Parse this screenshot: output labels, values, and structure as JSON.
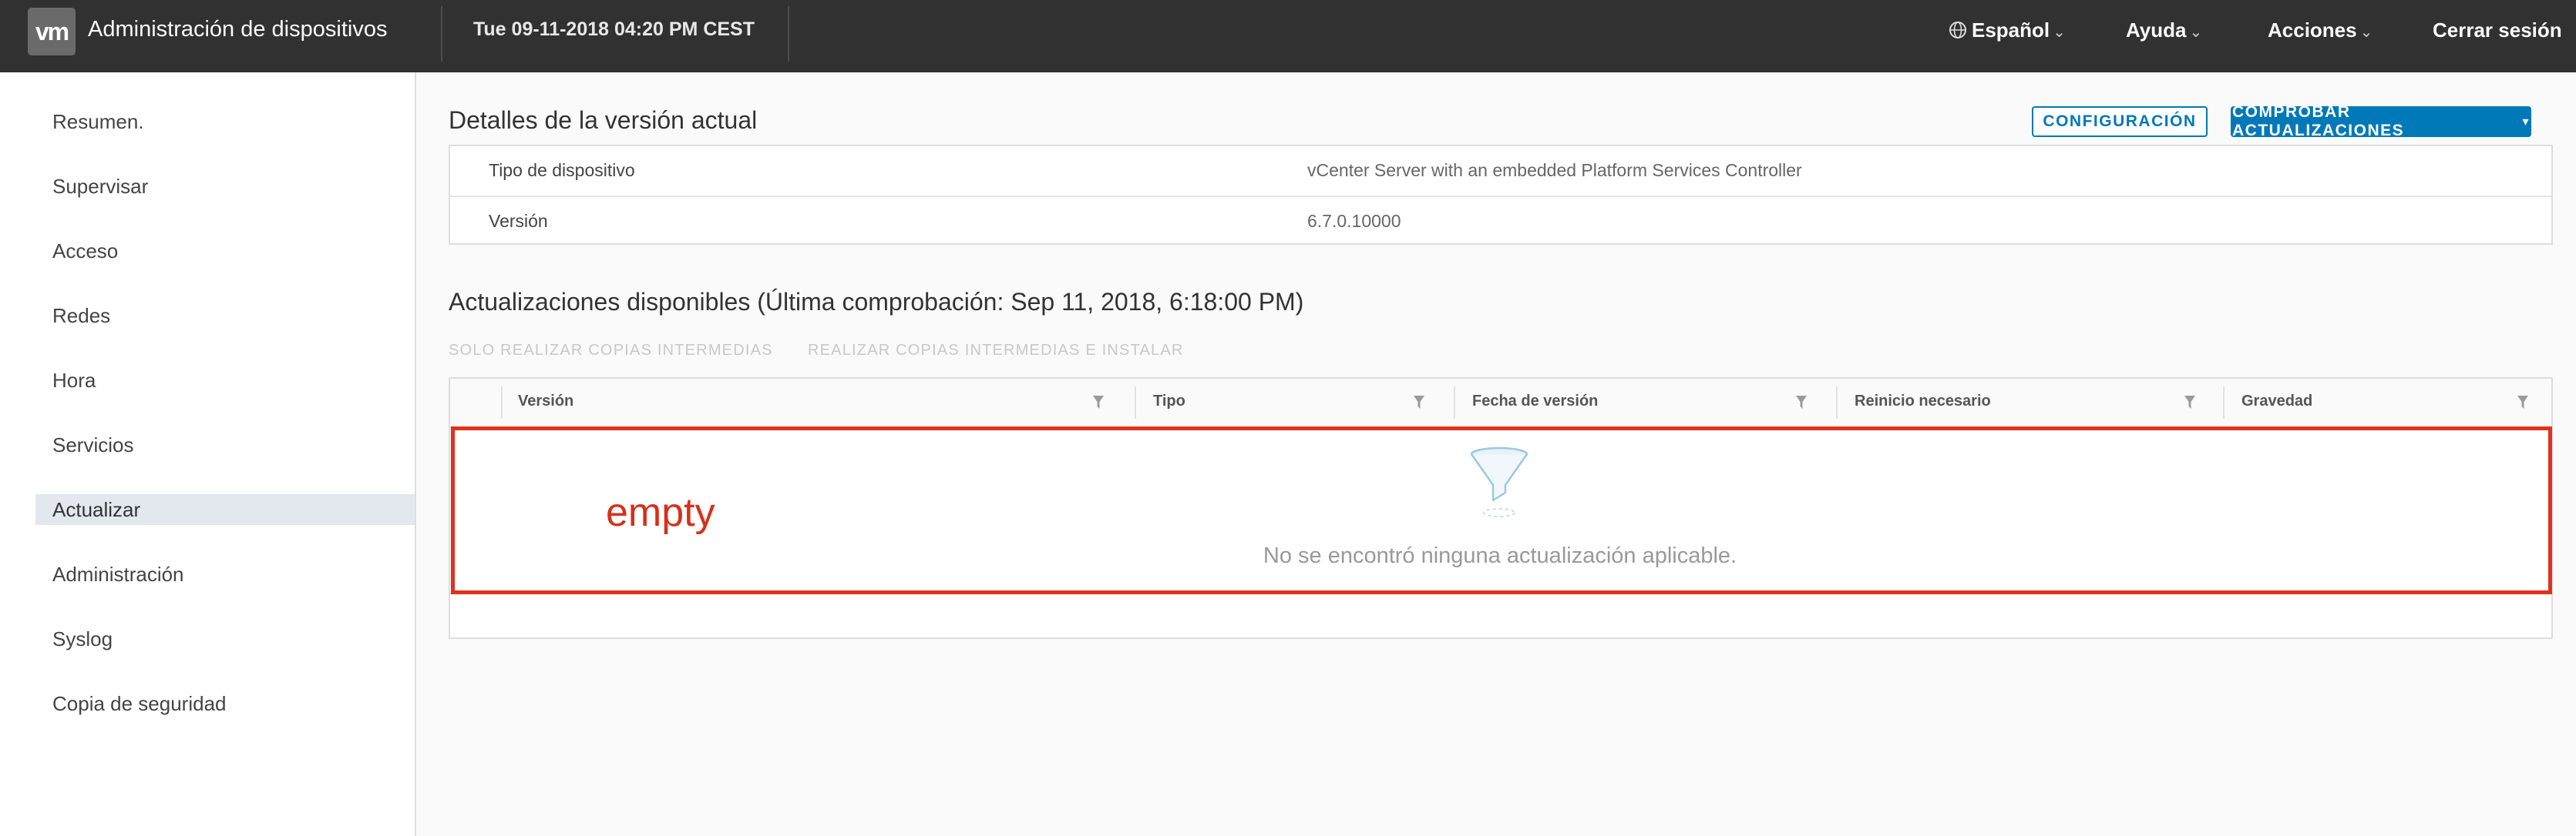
{
  "header": {
    "logo_text": "vm",
    "app_title": "Administración de dispositivos",
    "datetime": "Tue 09-11-2018 04:20 PM CEST",
    "nav": {
      "language": "Español",
      "help": "Ayuda",
      "actions": "Acciones",
      "logout": "Cerrar sesión"
    }
  },
  "sidebar": {
    "items": [
      {
        "label": "Resumen."
      },
      {
        "label": "Supervisar"
      },
      {
        "label": "Acceso"
      },
      {
        "label": "Redes"
      },
      {
        "label": "Hora"
      },
      {
        "label": "Servicios"
      },
      {
        "label": "Actualizar",
        "active": true
      },
      {
        "label": "Administración"
      },
      {
        "label": "Syslog"
      },
      {
        "label": "Copia de seguridad"
      }
    ]
  },
  "current_version": {
    "title": "Detalles de la versión actual",
    "config_button": "CONFIGURACIÓN",
    "check_updates_button": "COMPROBAR ACTUALIZACIONES",
    "rows": [
      {
        "label": "Tipo de dispositivo",
        "value": "vCenter Server with an embedded Platform Services Controller"
      },
      {
        "label": "Versión",
        "value": "6.7.0.10000"
      }
    ]
  },
  "updates": {
    "title": "Actualizaciones disponibles (Última comprobación: Sep 11, 2018, 6:18:00 PM)",
    "actions": [
      "SOLO REALIZAR COPIAS INTERMEDIAS",
      "REALIZAR COPIAS INTERMEDIAS E INSTALAR"
    ],
    "columns": [
      "Versión",
      "Tipo",
      "Fecha de versión",
      "Reinicio necesario",
      "Gravedad"
    ],
    "empty_message": "No se encontró ninguna actualización aplicable.",
    "annotation": "empty"
  },
  "colors": {
    "header_bg": "#313131",
    "accent": "#0079b8",
    "annotation": "#e0321c"
  }
}
